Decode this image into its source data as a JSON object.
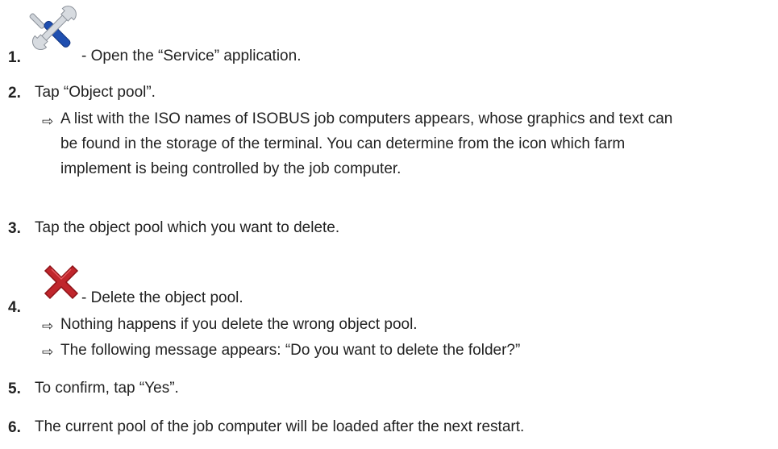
{
  "steps": [
    {
      "num": "1.",
      "icon": "wrench-screwdriver-icon",
      "text": "- Open the “Service” application."
    },
    {
      "num": "2.",
      "text": "Tap “Object pool”.",
      "result": "A list with the ISO names of ISOBUS job computers appears, whose graphics and text can be found in the storage of the terminal. You can determine from the icon which farm implement is being controlled by the job computer.",
      "result_lines": [
        "A list with the ISO names of ISOBUS job computers appears, whose graphics and text can",
        "be found in the storage of the terminal. You can determine from the icon which farm",
        "implement is being controlled by the job computer."
      ]
    },
    {
      "num": "3.",
      "text": "Tap the object pool which you want to delete."
    },
    {
      "num": "4.",
      "icon": "delete-x-icon",
      "text": "- Delete the object pool.",
      "results": [
        "Nothing happens if you delete the wrong object pool.",
        "The following message appears: “Do you want to delete the folder?”"
      ]
    },
    {
      "num": "5.",
      "text": "To confirm, tap “Yes”."
    },
    {
      "num": "6.",
      "text": "The current pool of the job computer will be loaded after the next restart."
    }
  ],
  "result_arrow": "⇨",
  "colors": {
    "text": "#222222",
    "delete_icon": "#c0262c",
    "screwdriver_shaft": "#1f4fb0"
  }
}
